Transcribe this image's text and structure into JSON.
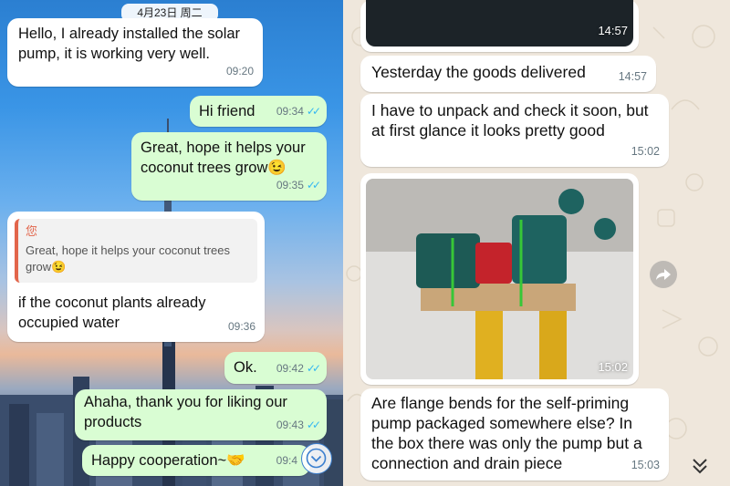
{
  "left_chat": {
    "date_chip": "4月23日 周二",
    "messages": [
      {
        "text": "Hello, I already installed the solar pump, it is working very well.",
        "time": "09:20"
      },
      {
        "text": "Hi friend",
        "time": "09:34",
        "ticks": "✓✓"
      },
      {
        "text": "Great, hope it helps your coconut trees grow😉",
        "time": "09:35",
        "ticks": "✓✓"
      },
      {
        "quote_author": "您",
        "quote_text": "Great, hope it helps your coconut trees grow😉",
        "text": "if the coconut plants already occupied water",
        "time": "09:36"
      },
      {
        "text": "Ok.",
        "time": "09:42",
        "ticks": "✓✓"
      },
      {
        "text": "Ahaha, thank you for liking our products",
        "time": "09:43",
        "ticks": "✓✓"
      },
      {
        "text": "Happy cooperation~🤝",
        "time": "09:4"
      }
    ],
    "scroll_down_icon": "chevron-down-circle-icon"
  },
  "right_chat": {
    "messages": [
      {
        "type": "image",
        "time": "14:57"
      },
      {
        "text": "Yesterday the goods delivered",
        "time": "14:57"
      },
      {
        "text": "I have to unpack and check it soon, but at first glance it looks pretty good",
        "time": "15:02"
      },
      {
        "type": "image",
        "time": "15:02"
      },
      {
        "text": "Are flange bends for the self-priming pump packaged somewhere else? In the box there was only the pump but a connection and drain piece",
        "time": "15:03"
      }
    ],
    "forward_icon": "forward-icon",
    "scroll_down_icon": "double-chevron-down-icon"
  },
  "colors": {
    "incoming_bubble": "#ffffff",
    "outgoing_bubble": "#d9fdd3",
    "read_ticks": "#34b7f1",
    "quote_accent": "#e2654b",
    "doodle_background": "#efe7dc"
  }
}
